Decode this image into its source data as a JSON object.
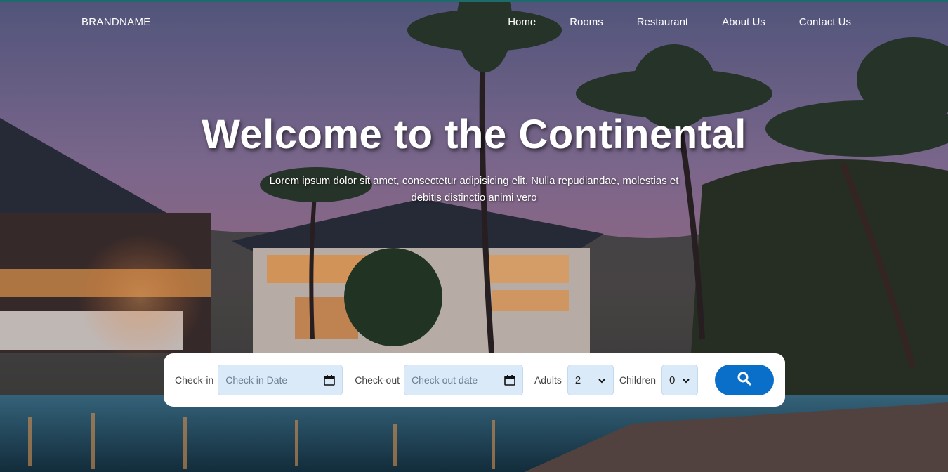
{
  "brand": "BRANDNAME",
  "nav": {
    "items": [
      {
        "label": "Home"
      },
      {
        "label": "Rooms"
      },
      {
        "label": "Restaurant"
      },
      {
        "label": "About Us"
      },
      {
        "label": "Contact Us"
      }
    ]
  },
  "hero": {
    "title": "Welcome to the Continental",
    "subtitle": "Lorem ipsum dolor sit amet, consectetur adipisicing elit. Nulla repudiandae, molestias et debitis distinctio animi vero"
  },
  "booking": {
    "checkin_label": "Check-in",
    "checkin_placeholder": "Check in Date",
    "checkout_label": "Check-out",
    "checkout_placeholder": "Check out date",
    "adults_label": "Adults",
    "adults_value": "2",
    "children_label": "Children",
    "children_value": "0",
    "search_icon": "search-icon"
  },
  "colors": {
    "accent": "#0a6fc9",
    "field_bg": "#dbeaf8",
    "top_border": "#1e6b6b"
  }
}
